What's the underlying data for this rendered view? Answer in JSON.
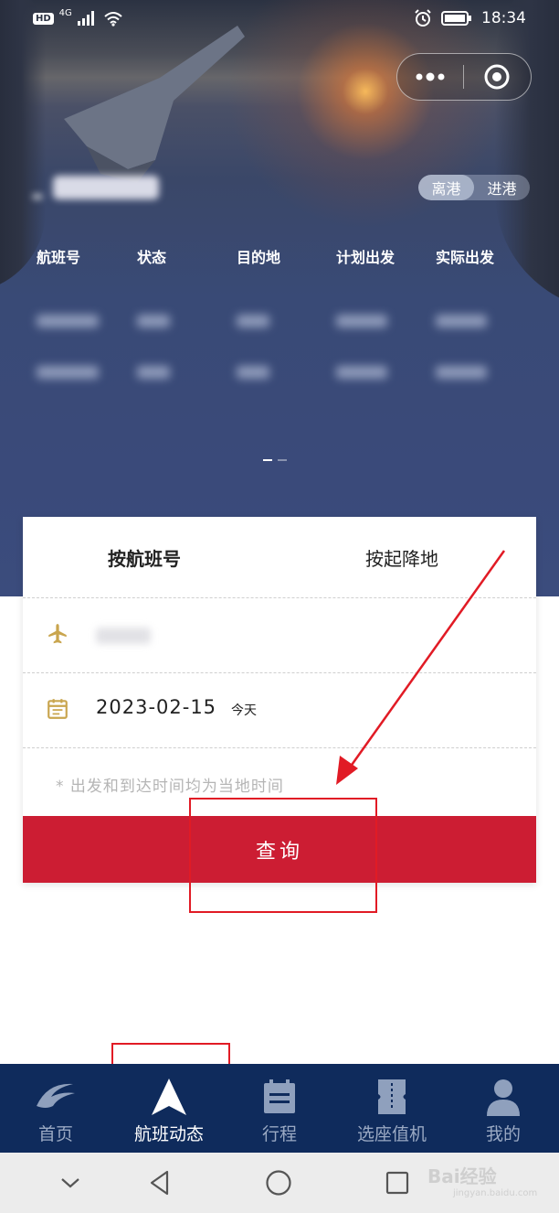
{
  "status_bar": {
    "badge": "HD",
    "network": "4G",
    "time": "18:34"
  },
  "hero": {
    "toggle": {
      "departure": "离港",
      "arrival": "进港",
      "selected": "departure"
    },
    "table_headers": [
      "航班号",
      "状态",
      "目的地",
      "计划出发",
      "实际出发"
    ]
  },
  "search_card": {
    "tabs": [
      {
        "label": "按航班号",
        "active": true
      },
      {
        "label": "按起降地",
        "active": false
      }
    ],
    "date": "2023-02-15",
    "date_hint": "今天",
    "note": "* 出发和到达时间均为当地时间",
    "query_label": "查询"
  },
  "tab_bar": {
    "items": [
      {
        "label": "首页",
        "icon": "airline-logo-icon",
        "active": false
      },
      {
        "label": "航班动态",
        "icon": "plane-arrow-icon",
        "active": true
      },
      {
        "label": "行程",
        "icon": "itinerary-icon",
        "active": false
      },
      {
        "label": "选座值机",
        "icon": "ticket-icon",
        "active": false
      },
      {
        "label": "我的",
        "icon": "person-icon",
        "active": false
      }
    ]
  },
  "watermark": {
    "text": "Bai经验",
    "sub": "jingyan.baidu.com"
  },
  "colors": {
    "accent_red": "#cc1d33",
    "tabbar_bg": "#0f2b5c",
    "icon_gold": "#c9a54e",
    "annotation_red": "#e11b25"
  }
}
